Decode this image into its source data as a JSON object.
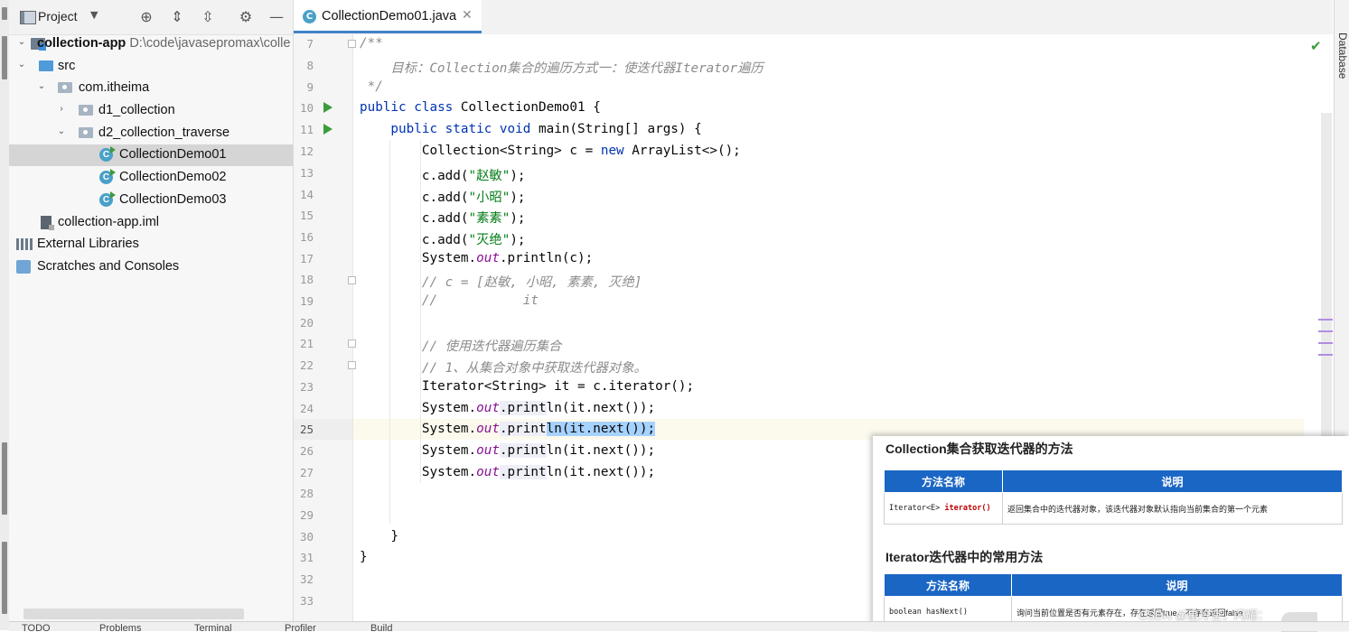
{
  "project_panel": {
    "title": "Project",
    "tree": [
      {
        "name": "collection-app",
        "path": "D:\\code\\javasepromax\\colle"
      },
      {
        "name": "src"
      },
      {
        "name": "com.itheima"
      },
      {
        "name": "d1_collection"
      },
      {
        "name": "d2_collection_traverse"
      },
      {
        "name": "CollectionDemo01"
      },
      {
        "name": "CollectionDemo02"
      },
      {
        "name": "CollectionDemo03"
      },
      {
        "name": "collection-app.iml"
      },
      {
        "name": "External Libraries"
      },
      {
        "name": "Scratches and Consoles"
      }
    ]
  },
  "editor": {
    "tab": "CollectionDemo01.java",
    "current_line": 25,
    "line_numbers": [
      "7",
      "8",
      "9",
      "10",
      "11",
      "12",
      "13",
      "14",
      "15",
      "16",
      "17",
      "18",
      "19",
      "20",
      "21",
      "22",
      "23",
      "24",
      "25",
      "26",
      "27",
      "28",
      "29",
      "30",
      "31",
      "32",
      "33"
    ],
    "code": {
      "l7": "/**",
      "l8": "    目标：Collection集合的遍历方式一：使迭代器Iterator遍历",
      "l9": " */",
      "l10_kw": "public class",
      "l10_rest": " CollectionDemo01 {",
      "l11_kw": "    public static void",
      "l11_rest": " main(String[] args) {",
      "l12_a": "        Collection<String> c = ",
      "l12_kw": "new",
      "l12_b": " ArrayList<>();",
      "l13_a": "        c.add(",
      "l13_s": "\"赵敏\"",
      "l13_b": ");",
      "l14_a": "        c.add(",
      "l14_s": "\"小昭\"",
      "l14_b": ");",
      "l15_a": "        c.add(",
      "l15_s": "\"素素\"",
      "l15_b": ");",
      "l16_a": "        c.add(",
      "l16_s": "\"灭绝\"",
      "l16_b": ");",
      "l17_a": "        System.",
      "l17_f": "out",
      "l17_b": ".println(c);",
      "l18": "        // c = [赵敏, 小昭, 素素, 灭绝]",
      "l19": "        //           it",
      "l21": "        // 使用迭代器遍历集合",
      "l22": "        // 1、从集合对象中获取迭代器对象。",
      "l23": "        Iterator<String> it = c.iterator();",
      "sys": "        System.",
      "out": "out",
      "print": ".print",
      "rest": "ln(it.next());",
      "l30": "    }",
      "l31": "}"
    }
  },
  "overlay": {
    "heading1": "Collection集合获取迭代器的方法",
    "heading2": "Iterator迭代器中的常用方法",
    "col_method": "方法名称",
    "col_desc": "说明",
    "row1_type": "Iterator<E> ",
    "row1_method": "iterator()",
    "row1_desc": "返回集合中的迭代器对象，该迭代器对象默认指向当前集合的第一个元素",
    "row2_method": "boolean hasNext()",
    "row2_desc": "询问当前位置是否有元素存在，存在返回true，不存在返回false",
    "watermark": "CSDN @星冷空，闪耀："
  },
  "right_strip": {
    "label": "Database"
  },
  "bottom_bar": [
    "TODO",
    "Problems",
    "Terminal",
    "Profiler",
    "Build"
  ],
  "colors": {
    "accent": "#4083c9",
    "keyword": "#0033b3",
    "string": "#067d17",
    "comment": "#8c8c8c",
    "table_header": "#1a66c4"
  }
}
